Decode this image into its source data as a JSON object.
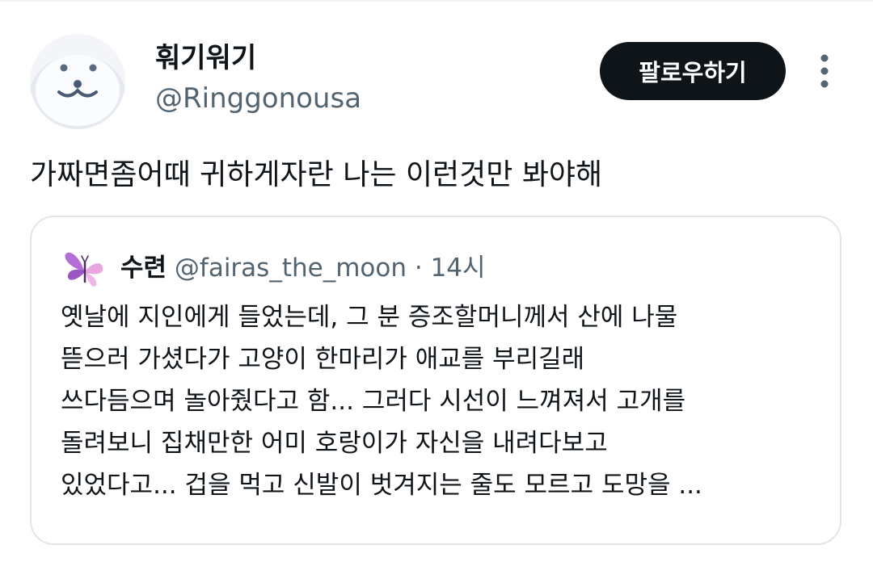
{
  "author": {
    "display_name": "훠기워기",
    "handle": "@Ringgonousa",
    "avatar_icon": "white-seal-face-icon"
  },
  "follow_button": {
    "label": "팔로우하기"
  },
  "more_icon": "vertical-ellipsis-icon",
  "tweet": {
    "text": "가짜면좀어때 귀하게자란 나는 이런것만 봐야해"
  },
  "quote": {
    "avatar_icon": "purple-butterfly-icon",
    "display_name": "수련",
    "handle": "@fairas_the_moon",
    "separator": "·",
    "time": "14시",
    "lines": [
      "옛날에 지인에게 들었는데, 그 분 증조할머니께서 산에 나물",
      "뜯으러 가셨다가 고양이 한마리가 애교를 부리길래",
      "쓰다듬으며 놀아줬다고 함... 그러다 시선이 느껴져서 고개를",
      "돌려보니 집채만한 어미 호랑이가 자신을 내려다보고",
      "있었다고... 겁을 먹고 신발이 벗겨지는 줄도 모르고 도망을 ..."
    ]
  },
  "colors": {
    "text_primary": "#0f1419",
    "text_secondary": "#536471",
    "button_background": "#0f1419",
    "border": "#e1e6ea"
  }
}
